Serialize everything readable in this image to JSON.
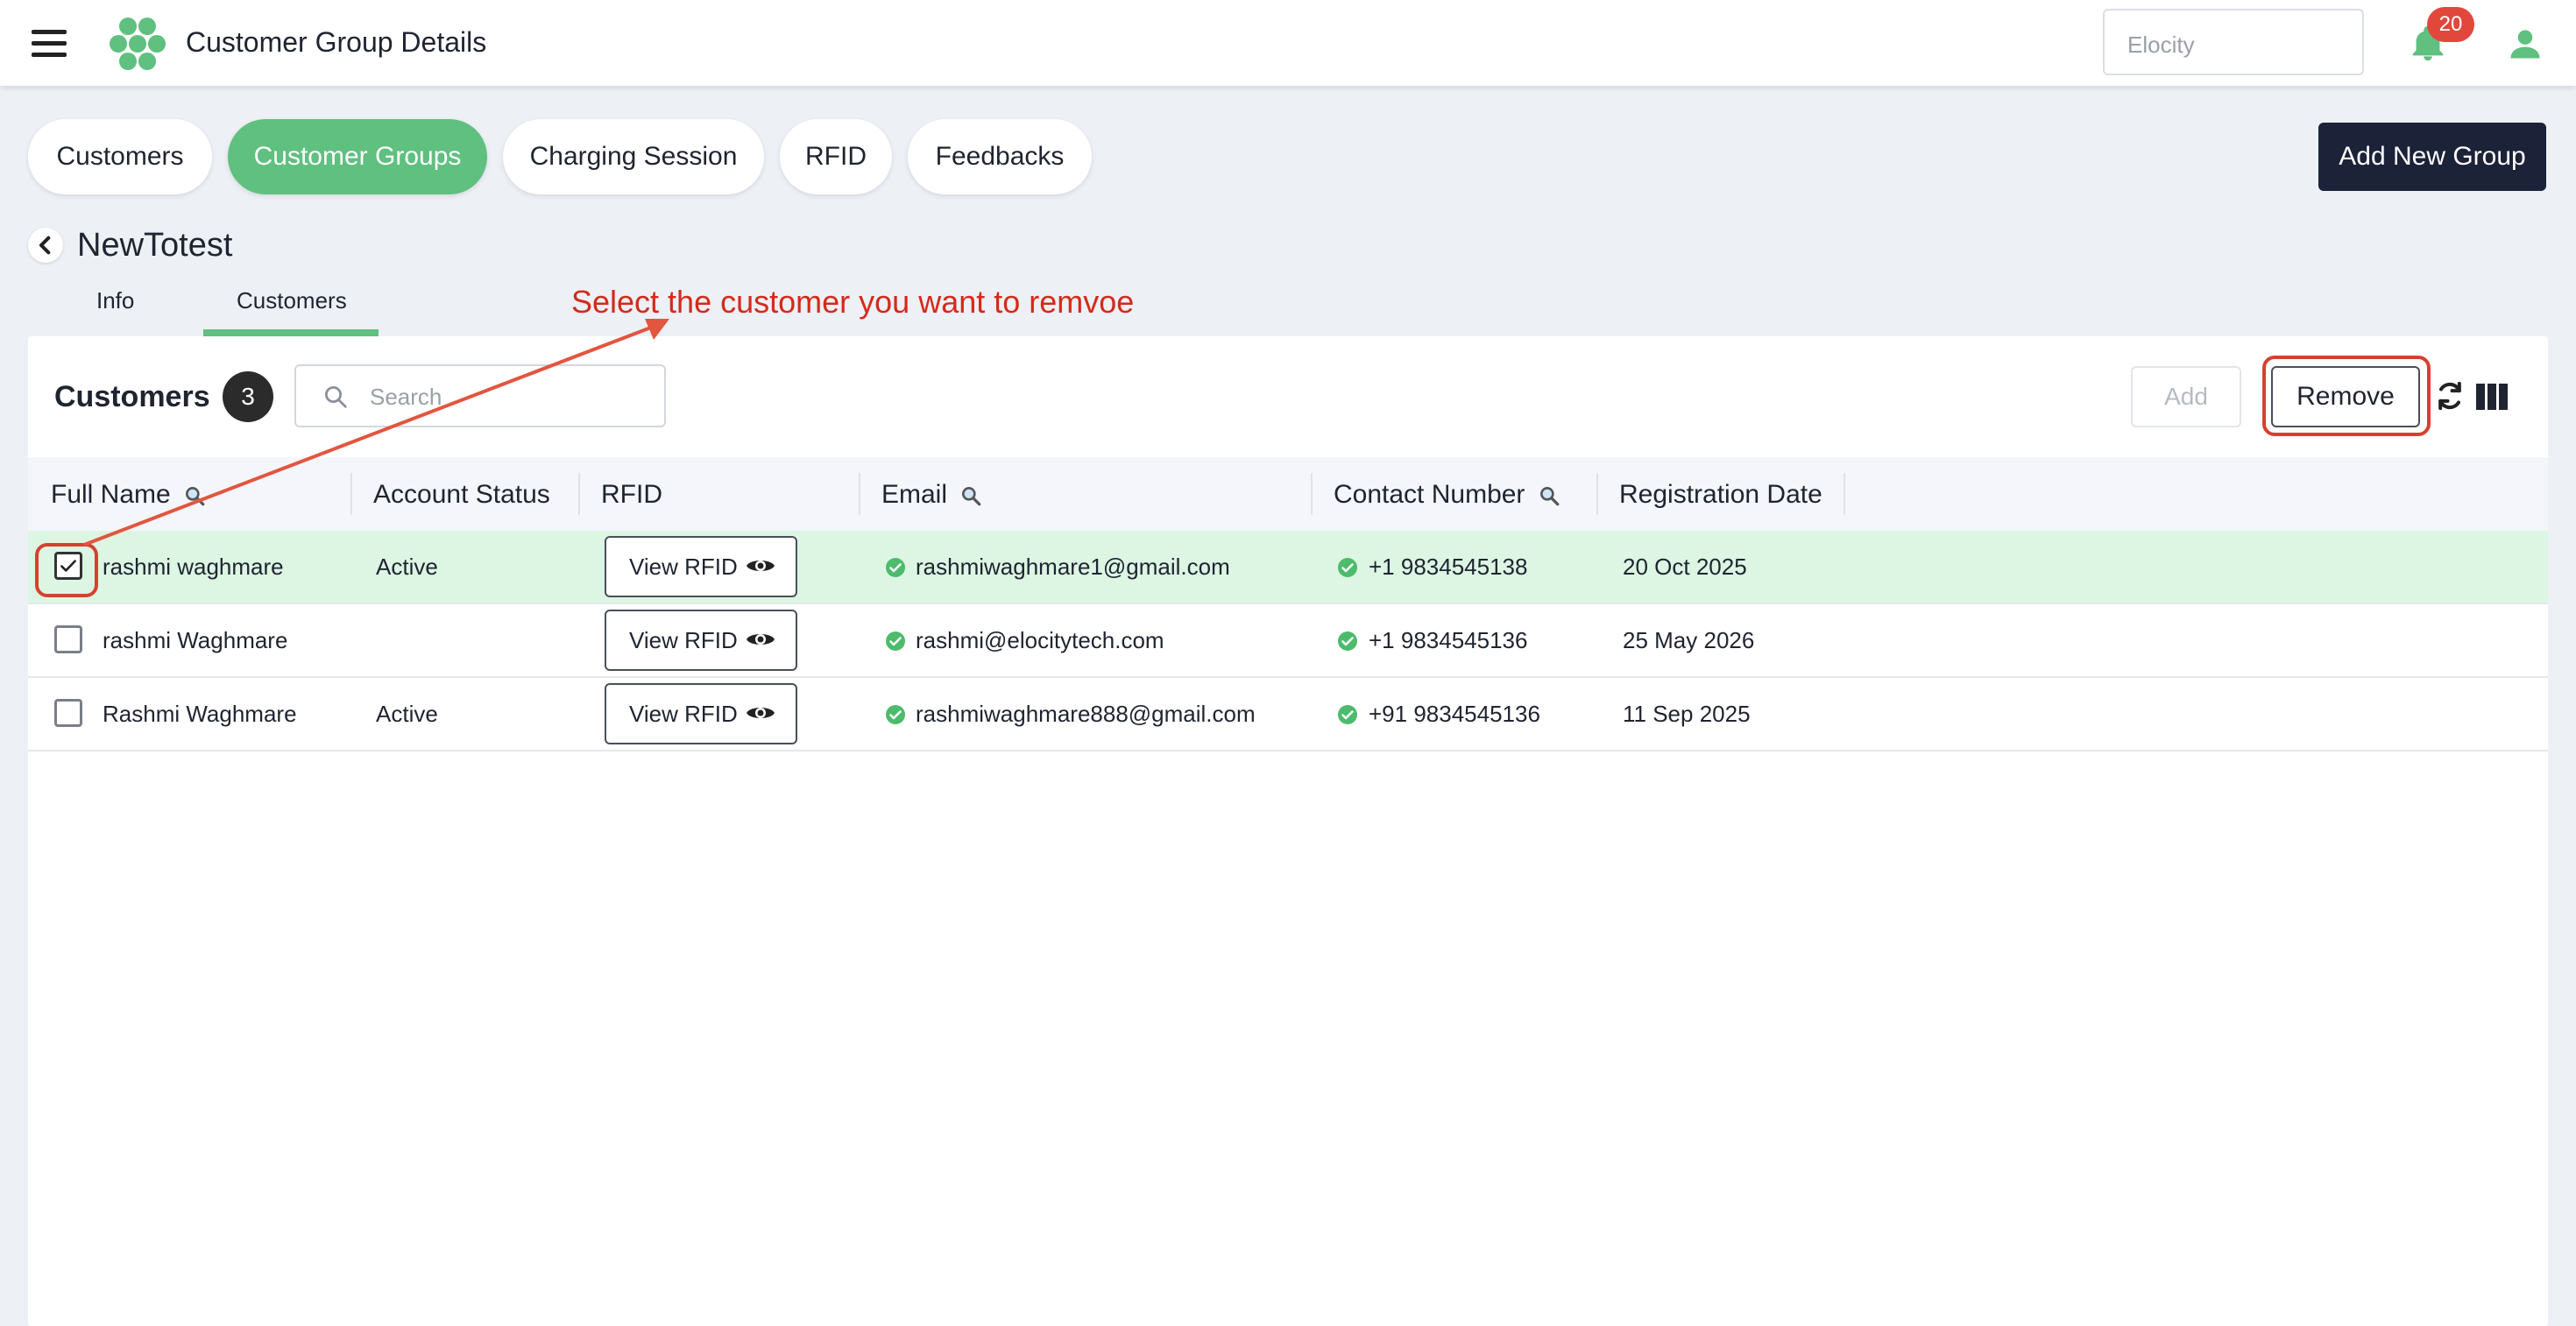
{
  "header": {
    "title": "Customer Group Details",
    "org_select_value": "Elocity",
    "notification_count": "20"
  },
  "nav": {
    "tabs": [
      {
        "label": "Customers"
      },
      {
        "label": "Customer Groups"
      },
      {
        "label": "Charging Session"
      },
      {
        "label": "RFID"
      },
      {
        "label": "Feedbacks"
      }
    ],
    "add_group_label": "Add New Group"
  },
  "group": {
    "name": "NewTotest",
    "subtabs": [
      {
        "label": "Info"
      },
      {
        "label": "Customers"
      }
    ]
  },
  "annotation": "Select the customer you want to remvoe",
  "panel": {
    "title": "Customers",
    "count": "3",
    "search_placeholder": "Search",
    "add_label": "Add",
    "remove_label": "Remove"
  },
  "table": {
    "columns": [
      "Full Name",
      "Account Status",
      "RFID",
      "Email",
      "Contact Number",
      "Registration Date"
    ],
    "view_rfid_label": "View RFID",
    "rows": [
      {
        "name": "rashmi waghmare",
        "status": "Active",
        "email": "rashmiwaghmare1@gmail.com",
        "phone": "+1 9834545138",
        "date": "20 Oct 2025",
        "selected": true
      },
      {
        "name": "rashmi Waghmare",
        "status": "",
        "email": "rashmi@elocitytech.com",
        "phone": "+1 9834545136",
        "date": "25 May 2026",
        "selected": false
      },
      {
        "name": "Rashmi Waghmare",
        "status": "Active",
        "email": "rashmiwaghmare888@gmail.com",
        "phone": "+91 9834545136",
        "date": "11 Sep 2025",
        "selected": false
      }
    ]
  },
  "colors": {
    "accent_green": "#5fc07f",
    "selected_row": "#dcf6e3",
    "dark_button": "#1c2238",
    "annotation_red": "#d42a1a",
    "badge_red": "#e2473b"
  },
  "icons": [
    "hamburger-icon",
    "logo-icon",
    "bell-icon",
    "user-icon",
    "back-icon",
    "search-icon",
    "refresh-icon",
    "columns-icon",
    "magnifier-icon",
    "eye-icon",
    "check-circle-icon",
    "checkbox-check-icon"
  ]
}
